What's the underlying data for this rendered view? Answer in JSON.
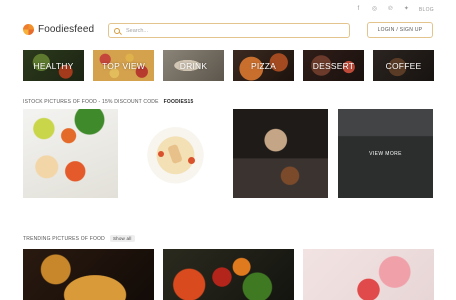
{
  "social": {
    "icons": [
      "facebook-icon",
      "instagram-icon",
      "pinterest-icon",
      "twitter-icon"
    ],
    "blog_label": "BLOG"
  },
  "header": {
    "logo_text": "Foodiesfeed",
    "search_placeholder": "Search...",
    "login_label": "LOGIN / SIGN UP"
  },
  "categories": [
    {
      "label": "HEALTHY"
    },
    {
      "label": "TOP VIEW"
    },
    {
      "label": "DRINK"
    },
    {
      "label": "PIZZA"
    },
    {
      "label": "DESSERT"
    },
    {
      "label": "COFFEE"
    }
  ],
  "istock": {
    "label": "ISTOCK PICTURES OF FOOD - 15% DISCOUNT CODE",
    "code": "FOODIES15",
    "view_more_label": "VIEW MORE"
  },
  "trending": {
    "label": "TRENDING PICTURES OF FOOD",
    "show_all_label": "Show all"
  },
  "colors": {
    "accent_border": "#e3c48c",
    "logo_orange": "#f2912b"
  }
}
